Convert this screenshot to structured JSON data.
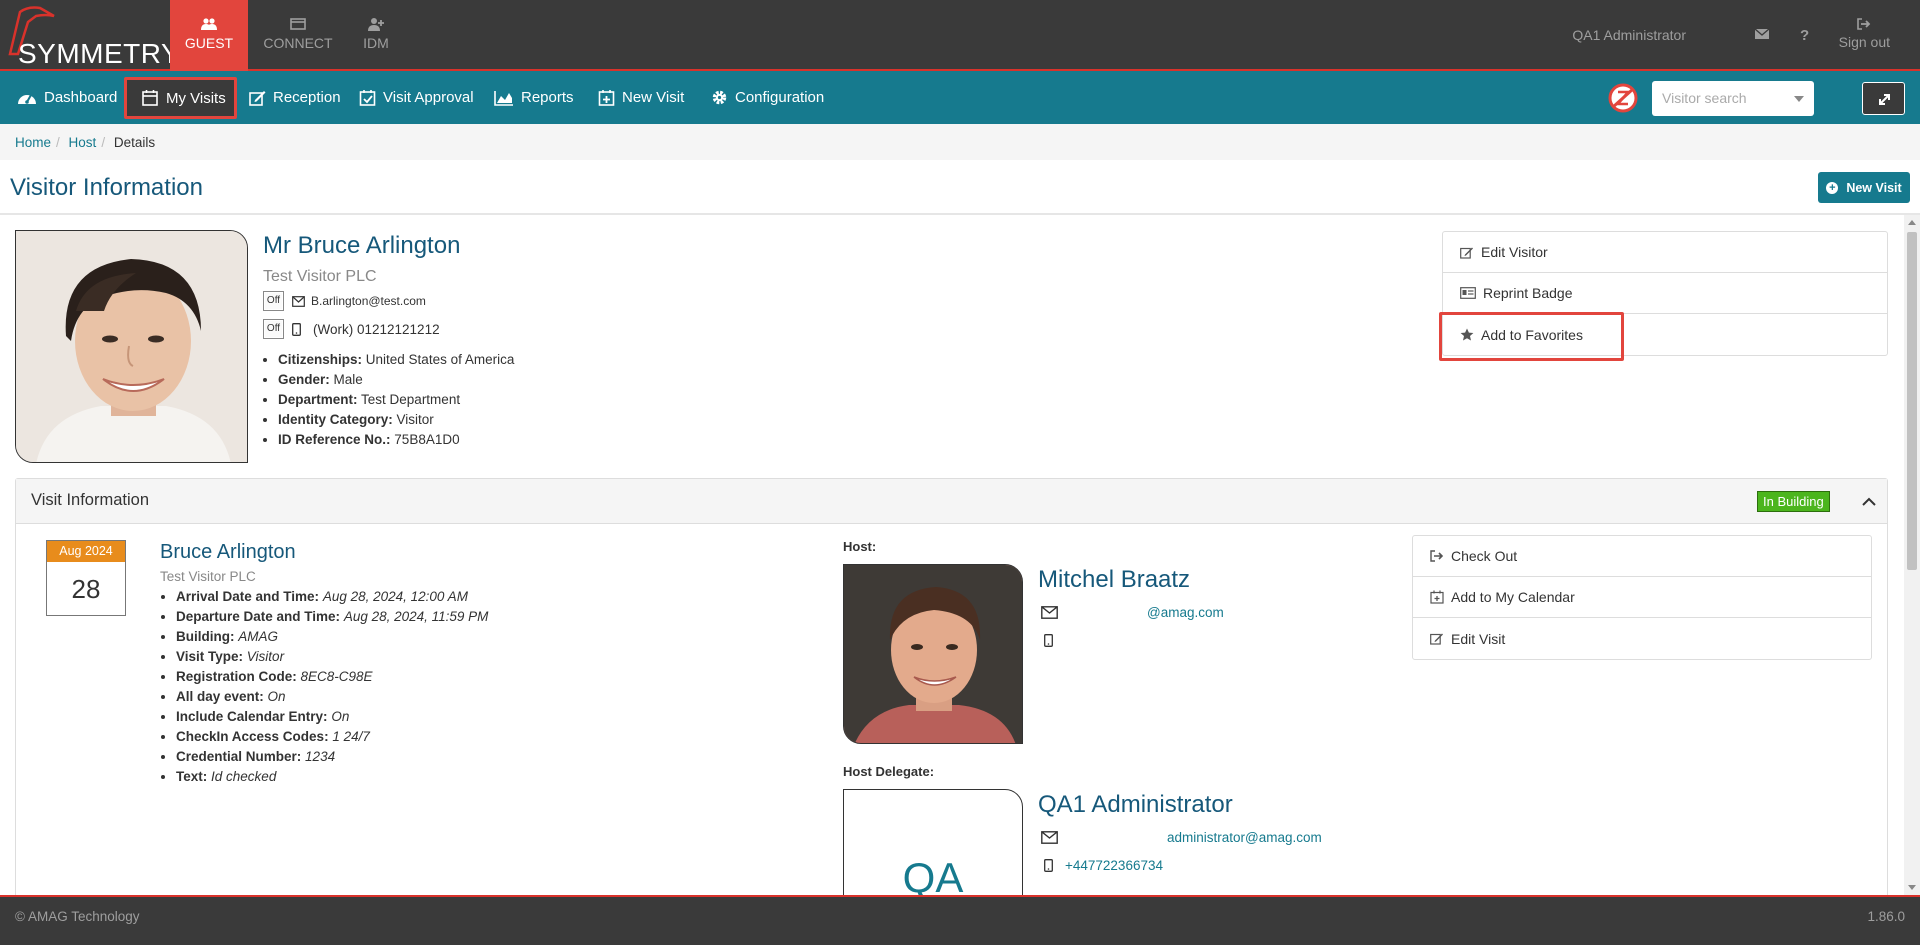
{
  "header": {
    "brand": "SYMMETRY",
    "brand_tm": "™",
    "modules": [
      {
        "label": "GUEST",
        "icon": "users-icon",
        "active": true
      },
      {
        "label": "CONNECT",
        "icon": "id-card-icon",
        "active": false
      },
      {
        "label": "IDM",
        "icon": "user-plus-icon",
        "active": false
      }
    ],
    "user": "QA1 Administrator",
    "signout": "Sign out"
  },
  "nav": {
    "items": [
      {
        "label": "Dashboard",
        "icon": "dashboard-icon"
      },
      {
        "label": "My Visits",
        "icon": "calendar-icon",
        "active": true
      },
      {
        "label": "Reception",
        "icon": "edit-icon"
      },
      {
        "label": "Visit Approval",
        "icon": "calendar-check-icon"
      },
      {
        "label": "Reports",
        "icon": "chart-icon"
      },
      {
        "label": "New Visit",
        "icon": "calendar-plus-icon"
      },
      {
        "label": "Configuration",
        "icon": "gear-icon"
      }
    ],
    "search_placeholder": "Visitor search"
  },
  "breadcrumb": {
    "items": [
      "Home",
      "Host",
      "Details"
    ]
  },
  "page": {
    "title": "Visitor Information",
    "new_visit": "New Visit"
  },
  "visitor": {
    "name": "Mr Bruce Arlington",
    "company": "Test Visitor PLC",
    "email": "B.arlington@test.com",
    "phone": "(Work) 01212121212",
    "off_tag": "Off",
    "attributes": [
      {
        "label": "Citizenships:",
        "value": "United States of America"
      },
      {
        "label": "Gender:",
        "value": "Male"
      },
      {
        "label": "Department:",
        "value": "Test Department"
      },
      {
        "label": "Identity Category:",
        "value": "Visitor"
      },
      {
        "label": "ID Reference No.:",
        "value": "75B8A1D0"
      }
    ],
    "actions": [
      {
        "label": "Edit Visitor",
        "icon": "edit-icon"
      },
      {
        "label": "Reprint Badge",
        "icon": "id-card-icon"
      },
      {
        "label": "Add to Favorites",
        "icon": "star-icon"
      }
    ]
  },
  "visit": {
    "panel_title": "Visit Information",
    "status": "In Building",
    "status_color": "#4bb51d",
    "calendar_month": "Aug 2024",
    "calendar_day": "28",
    "visitor_name": "Bruce Arlington",
    "visitor_company": "Test Visitor PLC",
    "details": [
      {
        "label": "Arrival Date and Time:",
        "value": "Aug 28, 2024, 12:00 AM"
      },
      {
        "label": "Departure Date and Time:",
        "value": "Aug 28, 2024, 11:59 PM"
      },
      {
        "label": "Building:",
        "value": "AMAG"
      },
      {
        "label": "Visit Type:",
        "value": "Visitor"
      },
      {
        "label": "Registration Code:",
        "value": "8EC8-C98E"
      },
      {
        "label": "All day event:",
        "value": "On"
      },
      {
        "label": "Include Calendar Entry:",
        "value": "On"
      },
      {
        "label": "CheckIn Access Codes:",
        "value": "1 24/7"
      },
      {
        "label": "Credential Number:",
        "value": "1234"
      },
      {
        "label": "Text:",
        "value": "Id checked"
      }
    ],
    "host_label": "Host:",
    "host_name": "Mitchel Braatz",
    "host_email": "@amag.com",
    "delegate_label": "Host Delegate:",
    "delegate_name": "QA1 Administrator",
    "delegate_initials": "QA",
    "delegate_email": "administrator@amag.com",
    "delegate_phone": "+447722366734",
    "actions": [
      {
        "label": "Check Out",
        "icon": "sign-out-icon"
      },
      {
        "label": "Add to My Calendar",
        "icon": "calendar-plus-icon"
      },
      {
        "label": "Edit Visit",
        "icon": "edit-icon"
      }
    ]
  },
  "footer": {
    "copyright": "© AMAG Technology",
    "version": "1.86.0"
  },
  "colors": {
    "brand_red": "#e2453d",
    "nav_teal": "#167a8e",
    "title_blue": "#16587a",
    "dark": "#3a3a3a",
    "calendar_orange": "#e88c1c"
  }
}
